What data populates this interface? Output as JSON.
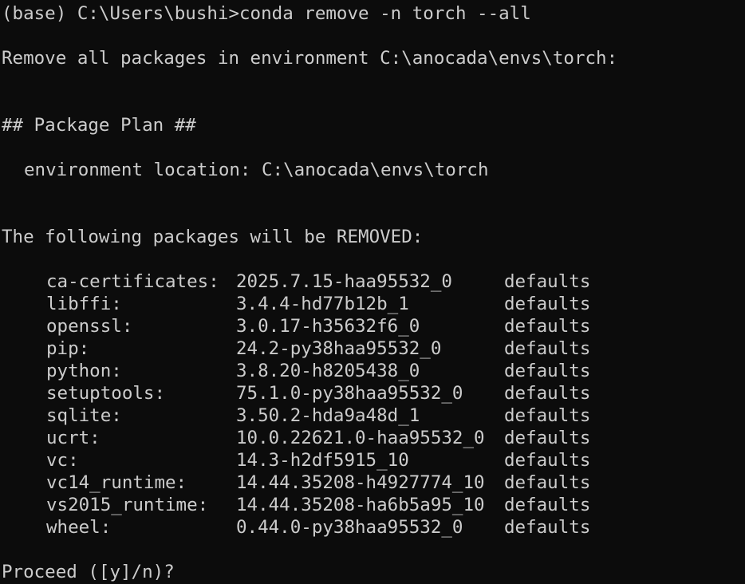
{
  "terminal": {
    "command_line": "(base) C:\\Users\\bushi>conda remove -n torch --all",
    "remove_notice": "Remove all packages in environment C:\\anocada\\envs\\torch:",
    "plan_heading": "## Package Plan ##",
    "environment_location": "environment location: C:\\anocada\\envs\\torch",
    "removed_heading": "The following packages will be REMOVED:",
    "packages": [
      {
        "name": "ca-certificates:",
        "version": "2025.7.15-haa95532_0",
        "channel": "defaults"
      },
      {
        "name": "libffi:",
        "version": "3.4.4-hd77b12b_1",
        "channel": "defaults"
      },
      {
        "name": "openssl:",
        "version": "3.0.17-h35632f6_0",
        "channel": "defaults"
      },
      {
        "name": "pip:",
        "version": "24.2-py38haa95532_0",
        "channel": "defaults"
      },
      {
        "name": "python:",
        "version": "3.8.20-h8205438_0",
        "channel": "defaults"
      },
      {
        "name": "setuptools:",
        "version": "75.1.0-py38haa95532_0",
        "channel": "defaults"
      },
      {
        "name": "sqlite:",
        "version": "3.50.2-hda9a48d_1",
        "channel": "defaults"
      },
      {
        "name": "ucrt:",
        "version": "10.0.22621.0-haa95532_0",
        "channel": "defaults"
      },
      {
        "name": "vc:",
        "version": "14.3-h2df5915_10",
        "channel": "defaults"
      },
      {
        "name": "vc14_runtime:",
        "version": "14.44.35208-h4927774_10",
        "channel": "defaults"
      },
      {
        "name": "vs2015_runtime:",
        "version": "14.44.35208-ha6b5a95_10",
        "channel": "defaults"
      },
      {
        "name": "wheel:",
        "version": "0.44.0-py38haa95532_0",
        "channel": "defaults"
      }
    ],
    "proceed_prompt": "Proceed ([y]/n)?"
  }
}
